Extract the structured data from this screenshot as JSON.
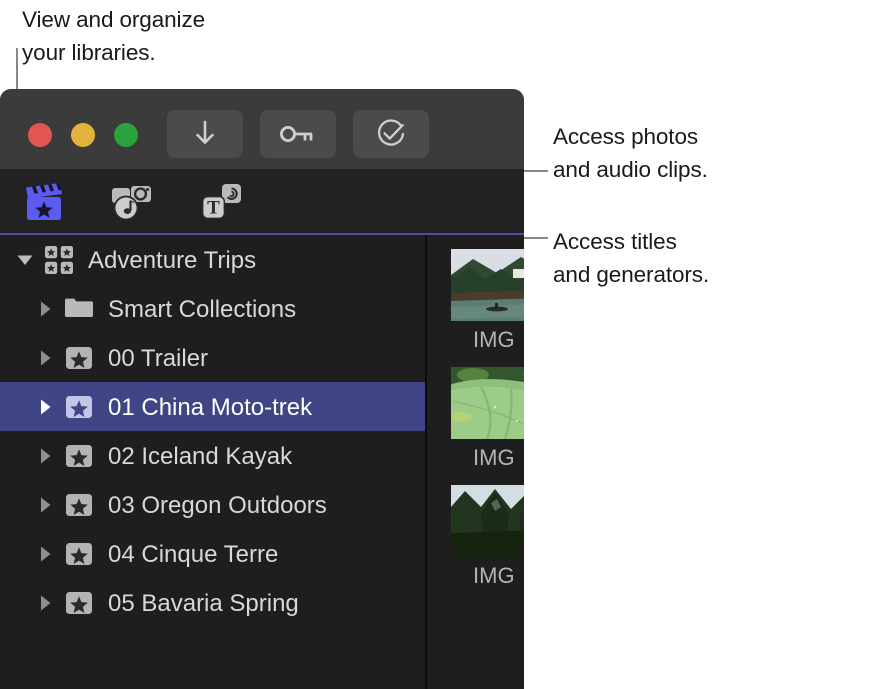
{
  "callouts": [
    {
      "id": "libraries",
      "text": "View and organize\nyour libraries."
    },
    {
      "id": "photos",
      "text": "Access photos\nand audio clips."
    },
    {
      "id": "titles",
      "text": "Access titles\nand generators."
    }
  ],
  "window": {
    "toolbar": {
      "traffic_lights": [
        {
          "name": "close",
          "color": "#e2564f"
        },
        {
          "name": "minimize",
          "color": "#e3b23c"
        },
        {
          "name": "zoom",
          "color": "#2aa33c"
        }
      ],
      "buttons": [
        {
          "name": "import-media",
          "icon": "download-arrow-icon",
          "label": "Import Media"
        },
        {
          "name": "keywords",
          "icon": "key-icon",
          "label": "Keywords"
        },
        {
          "name": "analyze",
          "icon": "check-circle-icon",
          "label": "Analyze and Fix"
        }
      ]
    },
    "browser_tabs": [
      {
        "name": "libraries",
        "icon": "clapperboard-star-icon",
        "label": "Libraries",
        "selected": true
      },
      {
        "name": "photos",
        "icon": "photos-audio-icon",
        "label": "Photos and Audio",
        "selected": false
      },
      {
        "name": "titles",
        "icon": "titles-generators-icon",
        "label": "Titles and Generators",
        "selected": false
      }
    ],
    "selected_tab_accent": "#4e4e9e",
    "sidebar": {
      "rows": [
        {
          "label": "Adventure Trips",
          "icon": "library-grid-icon",
          "level": 0,
          "expanded": true,
          "selected": false
        },
        {
          "label": "Smart Collections",
          "icon": "folder-icon",
          "level": 1,
          "expanded": false,
          "selected": false
        },
        {
          "label": "00 Trailer",
          "icon": "event-star-icon",
          "level": 1,
          "expanded": false,
          "selected": false
        },
        {
          "label": "01 China Moto-trek",
          "icon": "event-star-icon",
          "level": 1,
          "expanded": false,
          "selected": true
        },
        {
          "label": "02 Iceland Kayak",
          "icon": "event-star-icon",
          "level": 1,
          "expanded": false,
          "selected": false
        },
        {
          "label": "03 Oregon Outdoors",
          "icon": "event-star-icon",
          "level": 1,
          "expanded": false,
          "selected": false
        },
        {
          "label": "04 Cinque Terre",
          "icon": "event-star-icon",
          "level": 1,
          "expanded": false,
          "selected": false
        },
        {
          "label": "05 Bavaria Spring",
          "icon": "event-star-icon",
          "level": 1,
          "expanded": false,
          "selected": false
        }
      ],
      "selection_color": "#3f4585"
    },
    "browser": {
      "clips": [
        {
          "label": "IMG",
          "scene": "river-karst"
        },
        {
          "label": "IMG",
          "scene": "lotus-leaf"
        },
        {
          "label": "IMG",
          "scene": "karst-cliff"
        }
      ]
    }
  }
}
